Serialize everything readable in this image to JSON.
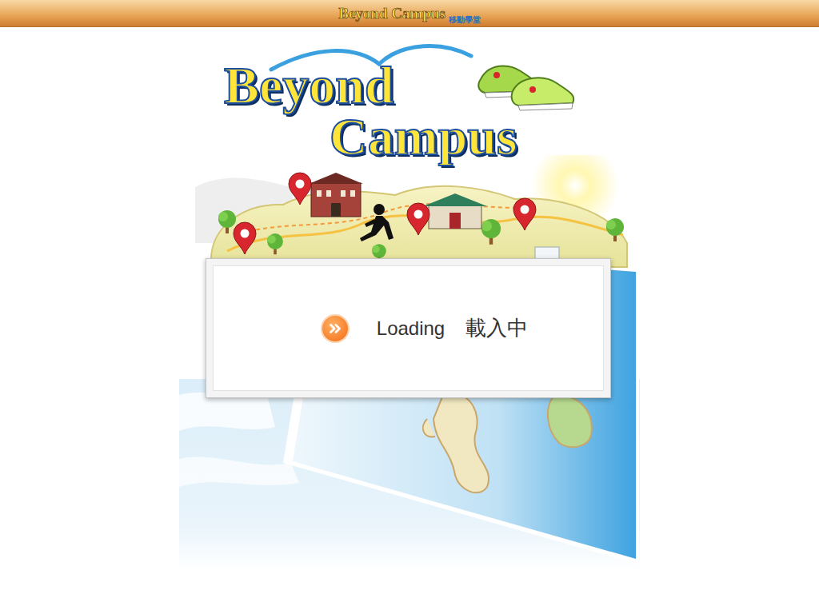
{
  "header": {
    "logo_title": "Beyond Campus",
    "logo_subtitle": "移動學堂"
  },
  "hero": {
    "title_line1": "Beyond",
    "title_line2": "Campus"
  },
  "loading": {
    "label": "Loading",
    "label_zh": "載入中"
  }
}
